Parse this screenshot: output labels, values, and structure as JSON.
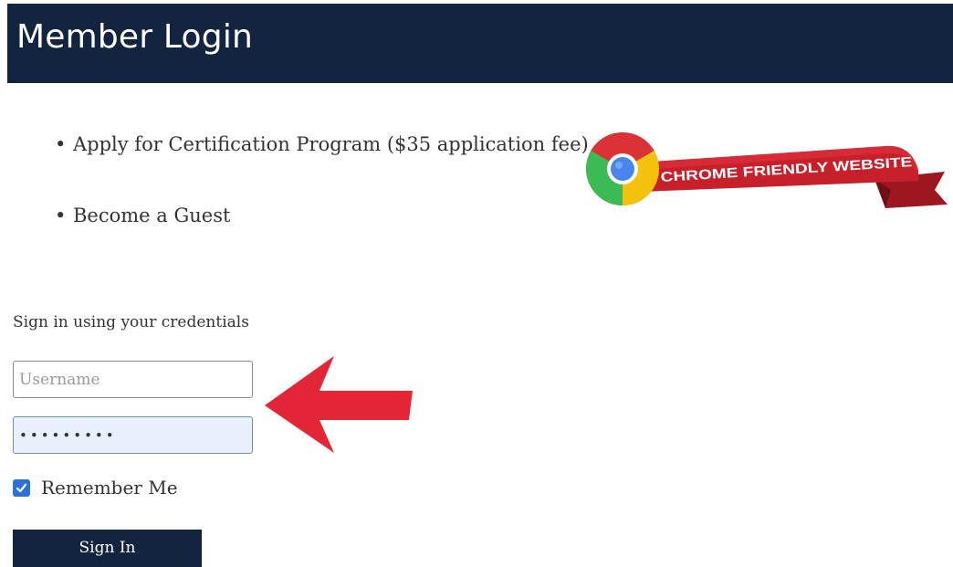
{
  "header": {
    "title": "Member Login",
    "background_color": "#13243f"
  },
  "links": {
    "items": [
      {
        "label": "Apply for Certification Program ($35 application fee)"
      },
      {
        "label": "Become a Guest"
      }
    ]
  },
  "badge": {
    "text": "CHROME FRIENDLY WEBSITE",
    "icon": "chrome-logo-icon",
    "ribbon_color": "#c8202b"
  },
  "login": {
    "heading": "Sign in using your credentials",
    "username": {
      "placeholder": "Username",
      "value": ""
    },
    "password": {
      "value": "•••••••••",
      "autofill_color": "#e8f0fe"
    },
    "remember_me": {
      "label": "Remember Me",
      "checked": true,
      "icon": "checkmark-icon",
      "color": "#2f6fd8"
    },
    "submit_label": "Sign In"
  },
  "annotation": {
    "icon": "arrow-left-icon",
    "color": "#e32636"
  }
}
